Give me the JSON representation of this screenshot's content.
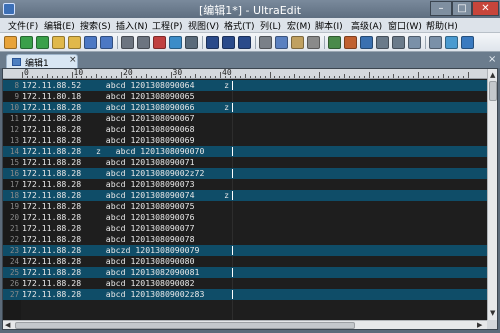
{
  "window": {
    "title": "[编辑1*] - UltraEdit",
    "minimize": "–",
    "maximize": "□",
    "close": "✕"
  },
  "menu": [
    "文件(F)",
    "编辑(E)",
    "搜索(S)",
    "插入(N)",
    "工程(P)",
    "视图(V)",
    "格式(T)",
    "列(L)",
    "宏(M)",
    "脚本(I)",
    "高级(A)",
    "窗口(W)",
    "帮助(H)"
  ],
  "toolbar": {
    "icons": [
      "new-file-icon",
      "back-icon",
      "forward-icon",
      "open-icon",
      "folder-icon",
      "save-icon",
      "save-all-icon",
      "print-icon",
      "print-preview-icon",
      "spellcheck-icon",
      "column-mode-icon",
      "hex-icon",
      "find-icon",
      "find-next-icon",
      "replace-icon",
      "cut-icon",
      "copy-icon",
      "paste-icon",
      "clipboard-icon",
      "word-wrap-icon",
      "html-icon",
      "bookmark-icon",
      "compare-icon",
      "settings-icon",
      "window-icon",
      "split-icon",
      "ftp-icon",
      "browser-icon"
    ]
  },
  "tab": {
    "label": "编辑1",
    "close": "×"
  },
  "strip_close": "×",
  "ruler": {
    "marks": [
      "0",
      "10",
      "20",
      "30",
      "40"
    ]
  },
  "editor": {
    "lines": [
      {
        "num": "8",
        "text": "172.11.88.52     abcd 1201308090064      z",
        "hl": true
      },
      {
        "num": "9",
        "text": "172.11.80.18     abcd 1201308090065",
        "hl": false
      },
      {
        "num": "10",
        "text": "172.11.88.28     abcd 1201308090066      z",
        "hl": true
      },
      {
        "num": "11",
        "text": "172.11.88.28     abcd 1201308090067",
        "hl": false
      },
      {
        "num": "12",
        "text": "172.11.88.28     abcd 1201308090068",
        "hl": false
      },
      {
        "num": "13",
        "text": "172.11.88.28     abcd 1201308090069",
        "hl": false
      },
      {
        "num": "14",
        "text": "172.11.88.28   z   abcd 1201308090070",
        "hl": true
      },
      {
        "num": "15",
        "text": "172.11.88.28     abcd 1201308090071",
        "hl": false
      },
      {
        "num": "16",
        "text": "172.11.88.28     abcd 120130809002z72",
        "hl": true
      },
      {
        "num": "17",
        "text": "172.11.88.28     abcd 1201308090073",
        "hl": false
      },
      {
        "num": "18",
        "text": "172.11.88.28     abcd 1201308090074      z",
        "hl": true
      },
      {
        "num": "19",
        "text": "172.11.88.28     abcd 1201308090075",
        "hl": false
      },
      {
        "num": "20",
        "text": "172.11.88.28     abcd 1201308090076",
        "hl": false
      },
      {
        "num": "21",
        "text": "172.11.88.28     abcd 1201308090077",
        "hl": false
      },
      {
        "num": "22",
        "text": "172.11.88.28     abcd 1201308090078",
        "hl": false
      },
      {
        "num": "23",
        "text": "172.11.88.28     abczd 1201308090079",
        "hl": true
      },
      {
        "num": "24",
        "text": "172.11.88.28     abcd 1201308090080",
        "hl": false
      },
      {
        "num": "25",
        "text": "172.11.88.28     abcd 12013082090081",
        "hl": true
      },
      {
        "num": "26",
        "text": "172.11.88.28     abcd 1201308090082",
        "hl": false
      },
      {
        "num": "27",
        "text": "172.11.88.28     abcd 120130809002z83",
        "hl": true
      }
    ]
  },
  "colors": {
    "highlight_row": "#0f4d68",
    "editor_bg": "#1e1e1e",
    "text": "#e8e8e8",
    "line_numbers": "#8a8a8a"
  }
}
